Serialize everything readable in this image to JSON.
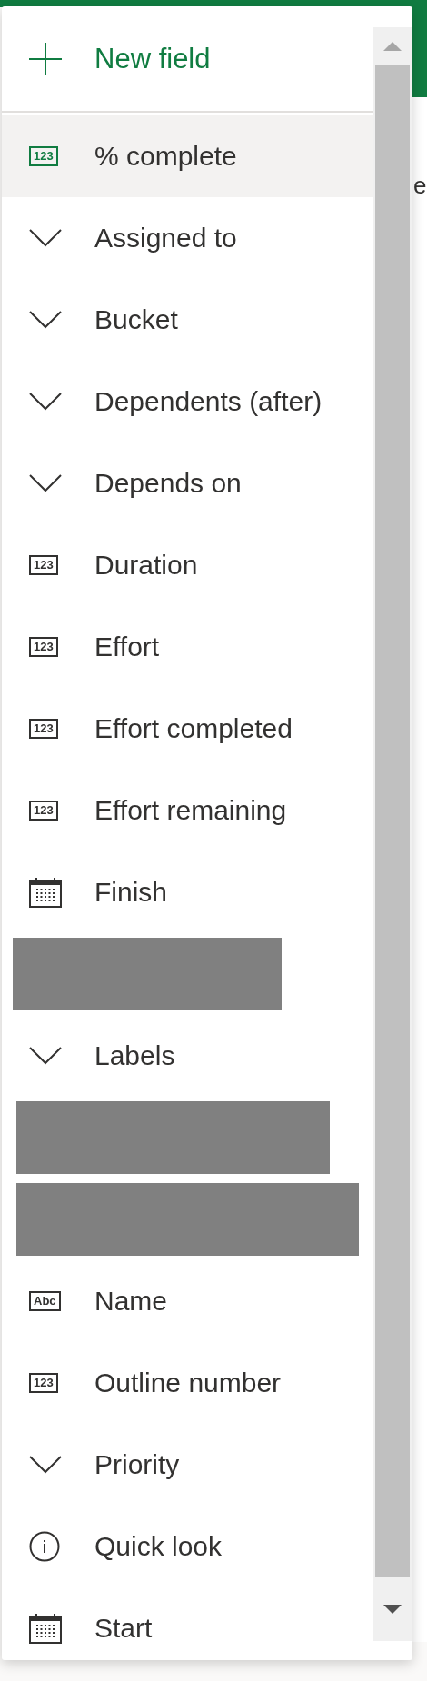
{
  "background_fragment": "e",
  "new_field": {
    "label": "New field"
  },
  "fields": [
    {
      "kind": "number",
      "icon_text": "123",
      "label": "% complete",
      "selected": true
    },
    {
      "kind": "choice",
      "label": "Assigned to",
      "selected": false
    },
    {
      "kind": "choice",
      "label": "Bucket",
      "selected": false
    },
    {
      "kind": "choice",
      "label": "Dependents (after)",
      "selected": false
    },
    {
      "kind": "choice",
      "label": "Depends on",
      "selected": false
    },
    {
      "kind": "number",
      "icon_text": "123",
      "label": "Duration",
      "selected": false
    },
    {
      "kind": "number",
      "icon_text": "123",
      "label": "Effort",
      "selected": false
    },
    {
      "kind": "number",
      "icon_text": "123",
      "label": "Effort completed",
      "selected": false
    },
    {
      "kind": "number",
      "icon_text": "123",
      "label": "Effort remaining",
      "selected": false
    },
    {
      "kind": "date",
      "label": "Finish",
      "selected": false
    },
    {
      "kind": "redacted"
    },
    {
      "kind": "choice",
      "label": "Labels",
      "selected": false
    },
    {
      "kind": "redacted"
    },
    {
      "kind": "redacted"
    },
    {
      "kind": "text",
      "icon_text": "Abc",
      "label": "Name",
      "selected": false
    },
    {
      "kind": "number",
      "icon_text": "123",
      "label": "Outline number",
      "selected": false
    },
    {
      "kind": "choice",
      "label": "Priority",
      "selected": false
    },
    {
      "kind": "info",
      "label": "Quick look",
      "selected": false
    },
    {
      "kind": "date",
      "label": "Start",
      "selected": false
    }
  ]
}
